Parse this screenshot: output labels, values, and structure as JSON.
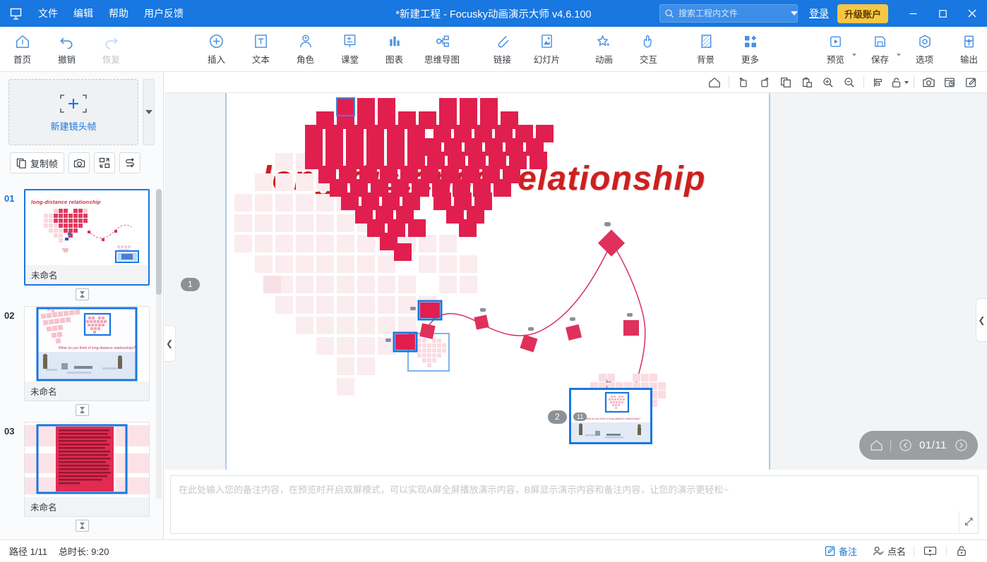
{
  "titlebar": {
    "logo_icon": "focusky-logo-icon",
    "menus": [
      {
        "label": "文件",
        "name": "menu-file"
      },
      {
        "label": "编辑",
        "name": "menu-edit"
      },
      {
        "label": "帮助",
        "name": "menu-help"
      },
      {
        "label": "用户反馈",
        "name": "menu-feedback"
      }
    ],
    "title": "*新建工程 - Focusky动画演示大师  v4.6.100",
    "search_placeholder": "搜索工程内文件",
    "search_value": "",
    "login_label": "登录",
    "upgrade_label": "升级账户",
    "minimize": "—",
    "maximize": "▢",
    "close": "✕",
    "accent_color": "#1877e0",
    "upgrade_color": "#f7c645"
  },
  "ribbon": {
    "groups": [
      {
        "items": [
          {
            "label": "首页",
            "icon": "home-icon",
            "name": "ribbon-home",
            "disabled": false
          },
          {
            "label": "撤销",
            "icon": "undo-icon",
            "name": "ribbon-undo",
            "disabled": false
          },
          {
            "label": "恢复",
            "icon": "redo-icon",
            "name": "ribbon-redo",
            "disabled": true
          }
        ]
      },
      {
        "items": [
          {
            "label": "插入",
            "icon": "plus-circle-icon",
            "name": "ribbon-insert",
            "disabled": false
          },
          {
            "label": "文本",
            "icon": "text-box-icon",
            "name": "ribbon-text",
            "disabled": false
          },
          {
            "label": "角色",
            "icon": "person-icon",
            "name": "ribbon-character",
            "disabled": false
          },
          {
            "label": "课堂",
            "icon": "classroom-icon",
            "name": "ribbon-classroom",
            "disabled": false
          },
          {
            "label": "图表",
            "icon": "bar-chart-icon",
            "name": "ribbon-chart",
            "disabled": false
          },
          {
            "label": "思维导图",
            "icon": "mindmap-icon",
            "name": "ribbon-mindmap",
            "disabled": false
          }
        ]
      },
      {
        "items": [
          {
            "label": "链接",
            "icon": "link-paperclip-icon",
            "name": "ribbon-link",
            "disabled": false
          },
          {
            "label": "幻灯片",
            "icon": "slideshow-icon",
            "name": "ribbon-slideshow",
            "disabled": false
          }
        ]
      },
      {
        "items": [
          {
            "label": "动画",
            "icon": "animation-star-icon",
            "name": "ribbon-animation",
            "disabled": false
          },
          {
            "label": "交互",
            "icon": "interaction-hand-icon",
            "name": "ribbon-interaction",
            "disabled": false
          }
        ]
      },
      {
        "items": [
          {
            "label": "背景",
            "icon": "background-icon",
            "name": "ribbon-background",
            "disabled": false
          },
          {
            "label": "更多",
            "icon": "more-grid-icon",
            "name": "ribbon-more",
            "disabled": false
          }
        ]
      },
      {
        "items": [
          {
            "label": "预览",
            "icon": "preview-play-icon",
            "name": "ribbon-preview",
            "disabled": false,
            "dropdown": true
          },
          {
            "label": "保存",
            "icon": "save-disk-icon",
            "name": "ribbon-save",
            "disabled": false,
            "dropdown": true
          },
          {
            "label": "选项",
            "icon": "options-gear-icon",
            "name": "ribbon-options",
            "disabled": false
          },
          {
            "label": "输出",
            "icon": "export-upload-icon",
            "name": "ribbon-export",
            "disabled": false
          }
        ]
      }
    ]
  },
  "left_panel": {
    "new_frame_label": "新建镜头帧",
    "new_frame_icon": "add-frame-icon",
    "scroll_down_icon": "chevron-down-icon",
    "tools": [
      {
        "label": "复制帧",
        "icon": "copy-frame-icon",
        "name": "copy-frame-button",
        "square": false
      },
      {
        "label": "",
        "icon": "camera-icon",
        "name": "capture-frame-button",
        "square": true
      },
      {
        "label": "",
        "icon": "fit-frame-icon",
        "name": "fit-frame-button",
        "square": true
      },
      {
        "label": "",
        "icon": "reorder-path-icon",
        "name": "reorder-frames-button",
        "square": true
      }
    ],
    "slides": [
      {
        "num": "01",
        "name": "未命名",
        "active": true,
        "thumb": "slide-1-heart-title"
      },
      {
        "num": "02",
        "name": "未命名",
        "active": false,
        "thumb": "slide-2-heart-winter"
      },
      {
        "num": "03",
        "name": "未命名",
        "active": false,
        "thumb": "slide-3-text-block"
      }
    ],
    "transition_icon": "hourglass-transition-icon",
    "collapse_icon": "chevron-left-icon"
  },
  "canvas_toolbar": {
    "buttons": [
      {
        "icon": "home-outline-icon",
        "name": "canvas-home-button"
      },
      {
        "icon": "rotate-left-icon",
        "name": "rotate-left-button"
      },
      {
        "icon": "rotate-right-icon",
        "name": "rotate-right-button"
      },
      {
        "icon": "copy-icon",
        "name": "copy-button"
      },
      {
        "icon": "paste-icon",
        "name": "paste-button"
      },
      {
        "icon": "zoom-in-icon",
        "name": "zoom-in-button"
      },
      {
        "icon": "zoom-out-icon",
        "name": "zoom-out-button"
      },
      {
        "icon": "align-icon",
        "name": "align-button"
      },
      {
        "icon": "unlock-icon",
        "name": "lock-button",
        "dropdown": true
      },
      {
        "icon": "screenshot-icon",
        "name": "screenshot-button"
      },
      {
        "icon": "history-icon",
        "name": "history-button"
      },
      {
        "icon": "edit-icon",
        "name": "edit-button"
      }
    ]
  },
  "canvas": {
    "title_text": "long-distance relationship",
    "title_color": "#cc2020",
    "heart_color": "#e01f4f",
    "heart_ghost_color": "#fbe8ec",
    "path_color": "#d8305f",
    "frame_markers": [
      {
        "label": "1",
        "name": "frame-marker-1"
      },
      {
        "label": "2",
        "name": "frame-marker-2"
      }
    ],
    "selection_color": "#1877e0"
  },
  "playback": {
    "home_icon": "home-icon",
    "prev_icon": "chevron-left-circle-icon",
    "next_icon": "chevron-right-circle-icon",
    "page_indicator": "01/11"
  },
  "notes": {
    "placeholder": "在此处输入您的备注内容，在预览时开启双屏模式，可以实现A屏全屏播放演示内容，B屏显示演示内容和备注内容，让您的演示更轻松~",
    "value": "",
    "expand_icon": "expand-diagonal-icon"
  },
  "statusbar": {
    "path_label": "路径 1/11",
    "duration_label": "总时长: 9:20",
    "actions": [
      {
        "label": "备注",
        "icon": "note-edit-icon",
        "name": "status-notes-button",
        "accent": true
      },
      {
        "label": "点名",
        "icon": "roll-call-icon",
        "name": "status-rollcall-button",
        "accent": false
      }
    ],
    "presenter_icon": "presenter-screen-icon",
    "lock_icon": "lock-icon"
  }
}
